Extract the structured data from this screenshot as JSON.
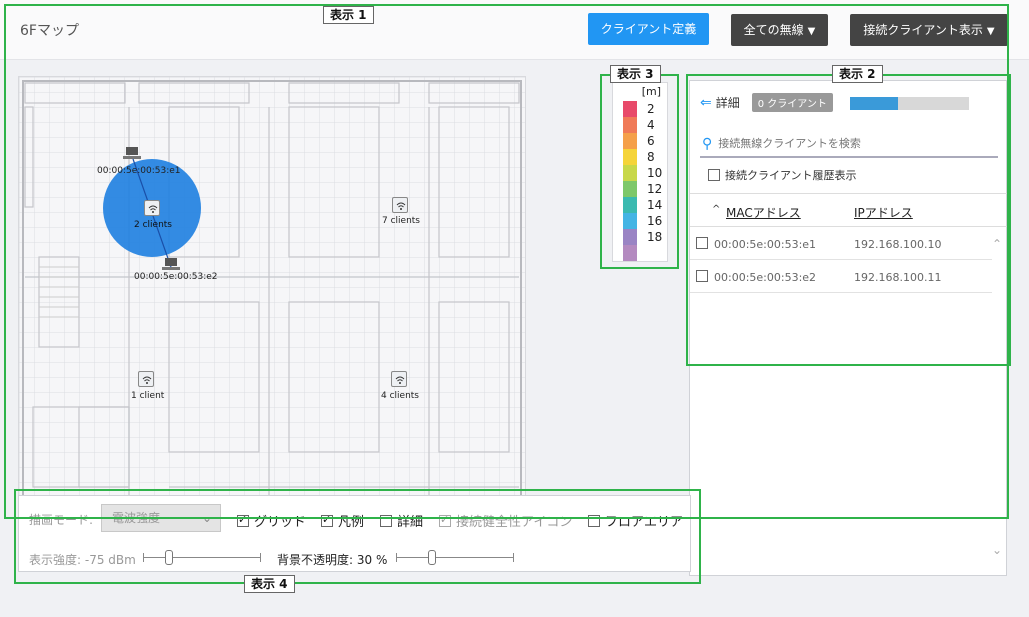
{
  "header": {
    "title": "6Fマップ",
    "client_define_label": "クライアント定義",
    "all_wireless_label": "全ての無線",
    "connected_display_label": "接続クライアント表示",
    "caret": "▼"
  },
  "map": {
    "devices": [
      {
        "mac": "00:00:5e:00:53:e1"
      },
      {
        "mac": "00:00:5e:00:53:e2"
      }
    ],
    "access_points": [
      {
        "clients_label": "2 clients"
      },
      {
        "clients_label": "7 clients"
      },
      {
        "clients_label": "1 client"
      },
      {
        "clients_label": "4 clients"
      }
    ],
    "coverage_color": "#1e7fe0"
  },
  "legend": {
    "unit": "[m]",
    "items": [
      {
        "value": "2",
        "color": "#e84a6a"
      },
      {
        "value": "4",
        "color": "#f07a58"
      },
      {
        "value": "6",
        "color": "#f5a04a"
      },
      {
        "value": "8",
        "color": "#f5d43a"
      },
      {
        "value": "10",
        "color": "#c8d84a"
      },
      {
        "value": "12",
        "color": "#7ec86a"
      },
      {
        "value": "14",
        "color": "#3bbab0"
      },
      {
        "value": "16",
        "color": "#44b4e4"
      },
      {
        "value": "18",
        "color": "#9a84c4"
      },
      {
        "value": "",
        "color": "#b48ac0"
      }
    ]
  },
  "panel": {
    "back_arrow": "⇐",
    "detail_label": "詳細",
    "badge": "0 クライアント",
    "progress_fraction": 0.4,
    "search_placeholder": "接続無線クライアントを検索",
    "history_label": "接続クライアント履歴表示",
    "columns": {
      "mac": "MACアドレス",
      "ip": "IPアドレス"
    },
    "sort_arrow": "^",
    "rows": [
      {
        "mac": "00:00:5e:00:53:e1",
        "ip": "192.168.100.10"
      },
      {
        "mac": "00:00:5e:00:53:e2",
        "ip": "192.168.100.11"
      }
    ]
  },
  "toolbar": {
    "mode_label": "描画モード:",
    "mode_value": "電波強度",
    "grid_label": "グリッド",
    "legend_label": "凡例",
    "detail_label": "詳細",
    "health_label": "接続健全性アイコン",
    "floor_area_label": "フロアエリア",
    "strength_label": "表示強度: -75 dBm",
    "opacity_label": "背景不透明度: 30 %"
  },
  "callouts": {
    "c1": "表示 1",
    "c2": "表示 2",
    "c3": "表示 3",
    "c4": "表示 4"
  }
}
